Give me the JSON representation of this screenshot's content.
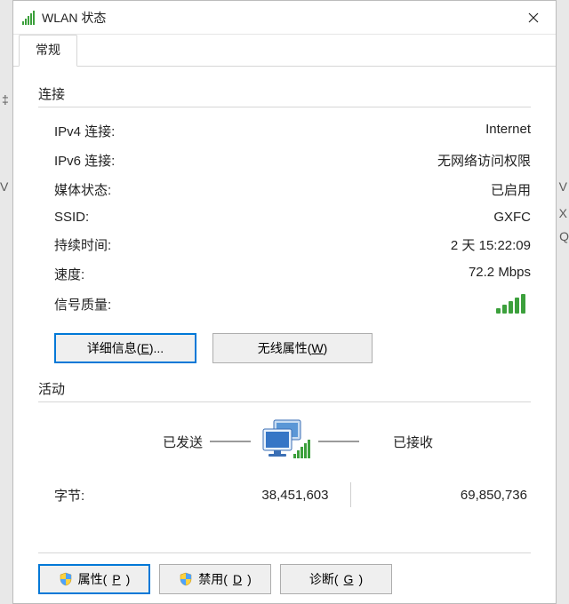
{
  "window": {
    "title": "WLAN 状态"
  },
  "tabs": {
    "general": "常规"
  },
  "connection": {
    "heading": "连接",
    "ipv4_label": "IPv4 连接:",
    "ipv4_value": "Internet",
    "ipv6_label": "IPv6 连接:",
    "ipv6_value": "无网络访问权限",
    "media_label": "媒体状态:",
    "media_value": "已启用",
    "ssid_label": "SSID:",
    "ssid_value": "GXFC",
    "duration_label": "持续时间:",
    "duration_value": "2 天 15:22:09",
    "speed_label": "速度:",
    "speed_value": "72.2 Mbps",
    "signal_label": "信号质量:",
    "details_btn": "详细信息(",
    "details_key": "E",
    "details_suffix": ")...",
    "wireless_btn": "无线属性(",
    "wireless_key": "W",
    "wireless_suffix": ")"
  },
  "activity": {
    "heading": "活动",
    "sent_label": "已发送",
    "recv_label": "已接收",
    "bytes_label": "字节:",
    "bytes_sent": "38,451,603",
    "bytes_recv": "69,850,736"
  },
  "footer": {
    "props_btn": "属性(",
    "props_key": "P",
    "props_suffix": ")",
    "disable_btn": "禁用(",
    "disable_key": "D",
    "disable_suffix": ")",
    "diag_btn": "诊断(",
    "diag_key": "G",
    "diag_suffix": ")"
  }
}
